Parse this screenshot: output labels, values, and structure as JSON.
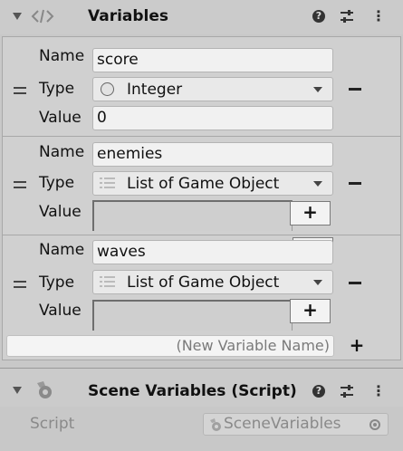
{
  "variables_component": {
    "title": "Variables",
    "icons": [
      "chevron-down-icon",
      "code-icon",
      "help-icon",
      "sliders-icon",
      "kebab-icon"
    ]
  },
  "labels": {
    "name": "Name",
    "type": "Type",
    "value": "Value"
  },
  "variables": [
    {
      "name": "score",
      "type": "Integer",
      "type_icon": "circle-icon",
      "value": "0"
    },
    {
      "name": "enemies",
      "type": "List of Game Object",
      "type_icon": "list-icon"
    },
    {
      "name": "waves",
      "type": "List of Game Object",
      "type_icon": "list-icon"
    }
  ],
  "new_variable": {
    "placeholder": "(New Variable Name)"
  },
  "scene_component": {
    "title": "Scene Variables (Script)",
    "script_label": "Script",
    "script_value": "SceneVariables"
  },
  "help_glyph": "?"
}
